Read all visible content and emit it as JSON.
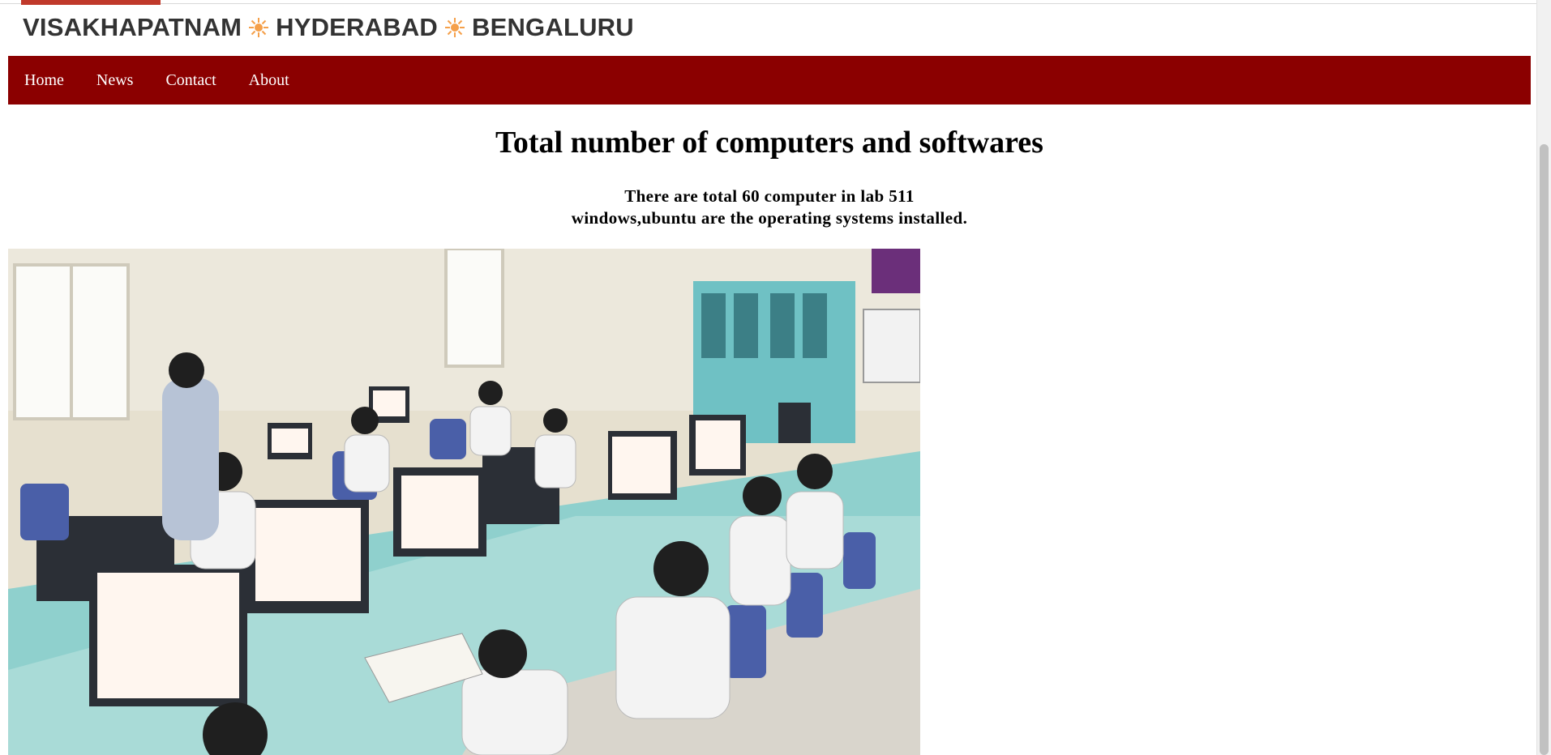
{
  "banner": {
    "cities": [
      "VISAKHAPATNAM",
      "HYDERABAD",
      "BENGALURU"
    ],
    "separator_icon": "sun-icon",
    "text_color": "#333333",
    "accent_color": "#f5a04a"
  },
  "nav": {
    "background": "#8b0000",
    "items": [
      {
        "label": "Home"
      },
      {
        "label": "News"
      },
      {
        "label": "Contact"
      },
      {
        "label": "About"
      }
    ]
  },
  "main": {
    "title": "Total number of computers and softwares",
    "info_line_1": "There are total 60 computer in lab 511",
    "info_line_2": "windows,ubuntu are the operating systems installed."
  },
  "image": {
    "subject": "computer-lab-photo"
  }
}
